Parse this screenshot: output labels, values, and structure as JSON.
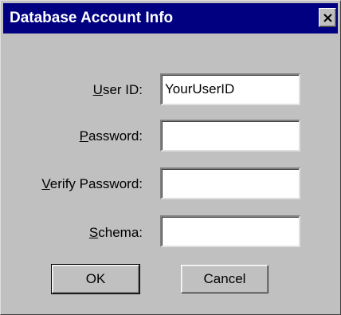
{
  "window": {
    "title": "Database Account Info",
    "close_icon": "close-icon"
  },
  "form": {
    "user_id": {
      "label_mnemonic": "U",
      "label_rest": "ser ID:",
      "value": "YourUserID"
    },
    "password": {
      "label_mnemonic": "P",
      "label_rest": "assword:",
      "value": ""
    },
    "verify_password": {
      "label_mnemonic": "V",
      "label_rest": "erify Password:",
      "value": ""
    },
    "schema": {
      "label_mnemonic": "S",
      "label_rest": "chema:",
      "value": ""
    }
  },
  "buttons": {
    "ok_label": "OK",
    "cancel_label": "Cancel"
  },
  "colors": {
    "titlebar": "#000080",
    "face": "#c0c0c0"
  }
}
